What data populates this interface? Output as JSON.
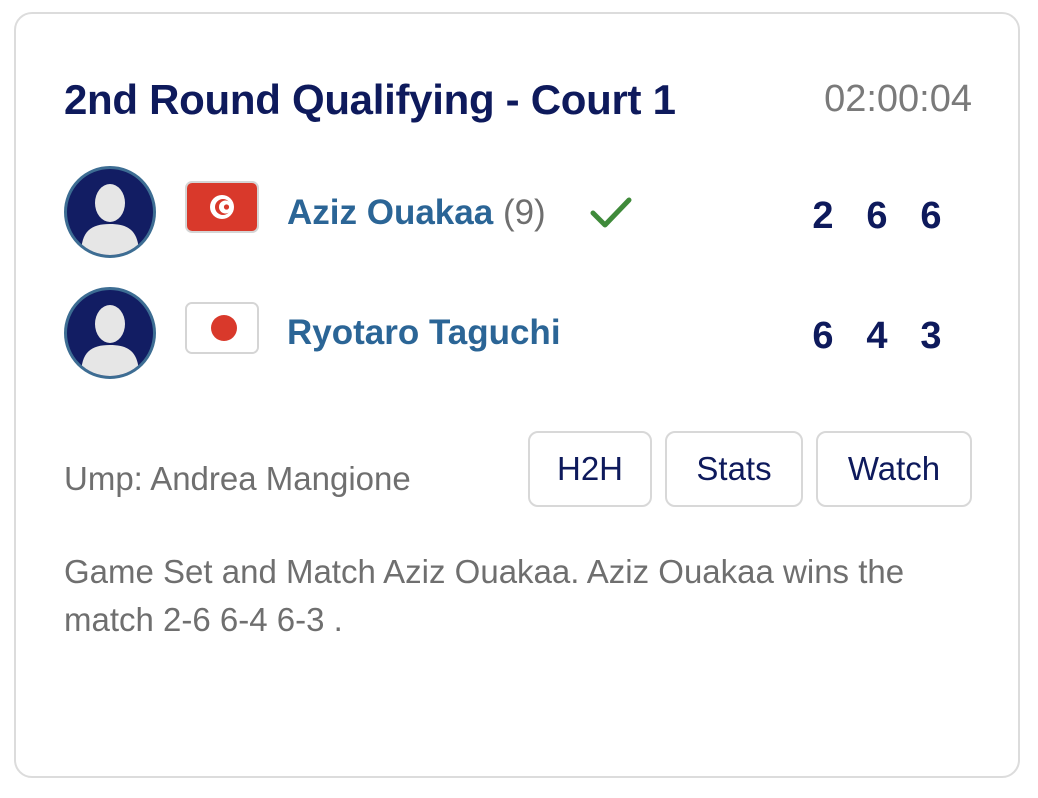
{
  "match": {
    "title": "2nd Round Qualifying - Court 1",
    "duration": "02:00:04",
    "umpire": "Ump: Andrea Mangione",
    "summary": "Game Set and Match Aziz Ouakaa. Aziz Ouakaa wins the match 2-6 6-4 6-3 ."
  },
  "players": [
    {
      "name": "Aziz Ouakaa",
      "seed": "(9)",
      "flag": "tunisia-flag",
      "winner": true,
      "scores": [
        "2",
        "6",
        "6"
      ]
    },
    {
      "name": "Ryotaro Taguchi",
      "seed": "",
      "flag": "japan-flag",
      "winner": false,
      "scores": [
        "6",
        "4",
        "3"
      ]
    }
  ],
  "buttons": {
    "h2h": "H2H",
    "stats": "Stats",
    "watch": "Watch"
  },
  "colors": {
    "title": "#0e1a5c",
    "player_name": "#2b6596",
    "winner_check": "#3f8a3a",
    "muted_text": "#6f6f6f",
    "avatar_bg": "#121d63"
  }
}
